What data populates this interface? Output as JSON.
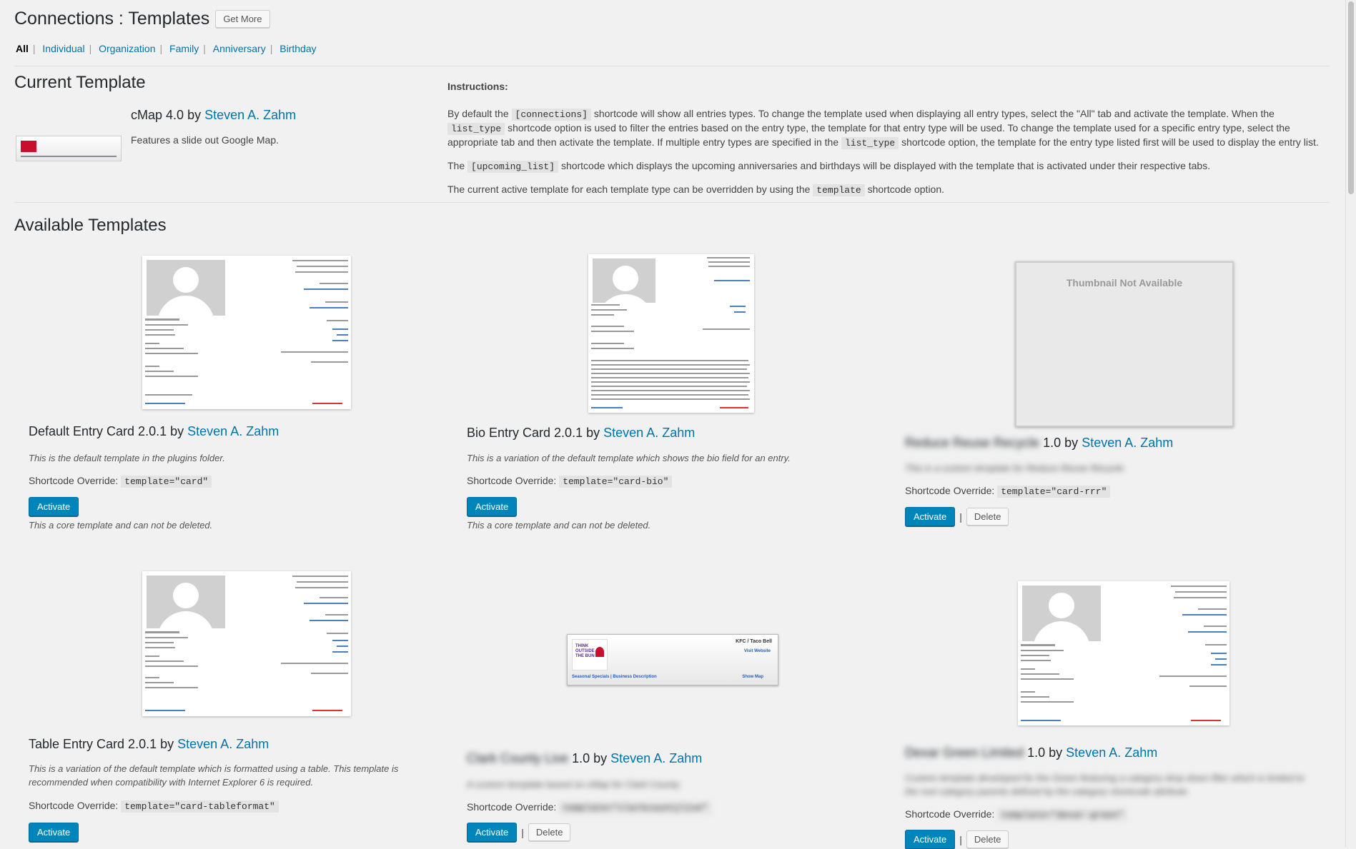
{
  "header": {
    "title": "Connections : Templates",
    "get_more_label": "Get More"
  },
  "filters": {
    "items": [
      "All",
      "Individual",
      "Organization",
      "Family",
      "Anniversary",
      "Birthday"
    ],
    "separator": "|",
    "active": "All"
  },
  "current": {
    "heading": "Current Template",
    "name": "cMap 4.0",
    "by": "by",
    "author": "Steven A. Zahm",
    "description": "Features a slide out Google Map."
  },
  "instructions": {
    "label": "Instructions:",
    "p1_a": "By default the",
    "p1_code1": "[connections]",
    "p1_b": "shortcode will show all entries types. To change the template used when displaying all entry types, select the \"All\" tab and activate the template. When the",
    "p1_code2": "list_type",
    "p1_c": "shortcode option is used to filter the entries based on the entry type, the template for that entry type will be used. To change the template used for a specific entry type, select the appropriate tab and then activate the template. If multiple entry types are specified in the",
    "p1_code3": "list_type",
    "p1_d": "shortcode option, the template for the entry type listed first will be used to display the entry list.",
    "p2_a": "The",
    "p2_code": "[upcoming_list]",
    "p2_b": "shortcode which displays the upcoming anniversaries and birthdays will be displayed with the template that is activated under their respective tabs.",
    "p3_a": "The current active template for each template type can be overridden by using the",
    "p3_code": "template",
    "p3_b": "shortcode option."
  },
  "available": {
    "heading": "Available Templates",
    "shortcode_label": "Shortcode Override:",
    "activate_label": "Activate",
    "delete_label": "Delete",
    "by": "by",
    "thumb_not_available": "Thumbnail Not Available",
    "templates": [
      {
        "name": "Default Entry Card 2.0.1",
        "author": "Steven A. Zahm",
        "description": "This is the default template in the plugins folder.",
        "shortcode": "template=\"card\"",
        "note": "This a core template and can not be deleted."
      },
      {
        "name": "Bio Entry Card 2.0.1",
        "author": "Steven A. Zahm",
        "description": "This is a variation of the default template which shows the bio field for an entry.",
        "shortcode": "template=\"card-bio\"",
        "note": "This a core template and can not be deleted."
      },
      {
        "name_blurred": "Reduce Reuse Recycle",
        "version": "1.0",
        "author": "Steven A. Zahm",
        "description": "This is a custom template for Reduce Reuse Recycle.",
        "shortcode": "template=\"card-rrr\""
      },
      {
        "name": "Table Entry Card 2.0.1",
        "author": "Steven A. Zahm",
        "description": "This is a variation of the default template which is formatted using a table. This template is recommended when compatibility with Internet Explorer 6 is required.",
        "shortcode": "template=\"card-tableformat\""
      },
      {
        "name_blurred": "Clark County Live",
        "version": "1.0",
        "author": "Steven A. Zahm",
        "description": "A custom template based on cMap for Clark County.",
        "shortcode": "template=\"clarkcountylive\""
      },
      {
        "name_blurred": "Dexar Green Limited",
        "version": "1.0",
        "author": "Steven A. Zahm",
        "description": "Custom template developed for the Green featuring a category drop down filter which is limited to the root category parents defined by the category shortcode attribute.",
        "shortcode": "template=\"dexar-green\""
      }
    ]
  },
  "entry_card_sample": {
    "name": "John Q. Smith",
    "home_phone": "Home Phone: (503) 456-2648",
    "cell_phone": "Cell Phone: (503) 789-8462",
    "work_phone": "Work Phone: (503) 159-6462",
    "website": "Website: http://connections-pro.com",
    "birthday": "Birthday: August 14",
    "add_link": "Add to Address Book",
    "updated": "UPDATED 7 MIN AGO"
  },
  "kfc_thumb": {
    "title": "KFC / Taco Bell",
    "visit": "Visit Website",
    "footer": "Seasonal Specials | Business Description",
    "show_map": "Show Map",
    "logo_text": "THINK OUTSIDE THE BUN"
  },
  "colors": {
    "link": "#0073aa",
    "primary_button": "#0085ba",
    "background": "#f1f1f1"
  }
}
